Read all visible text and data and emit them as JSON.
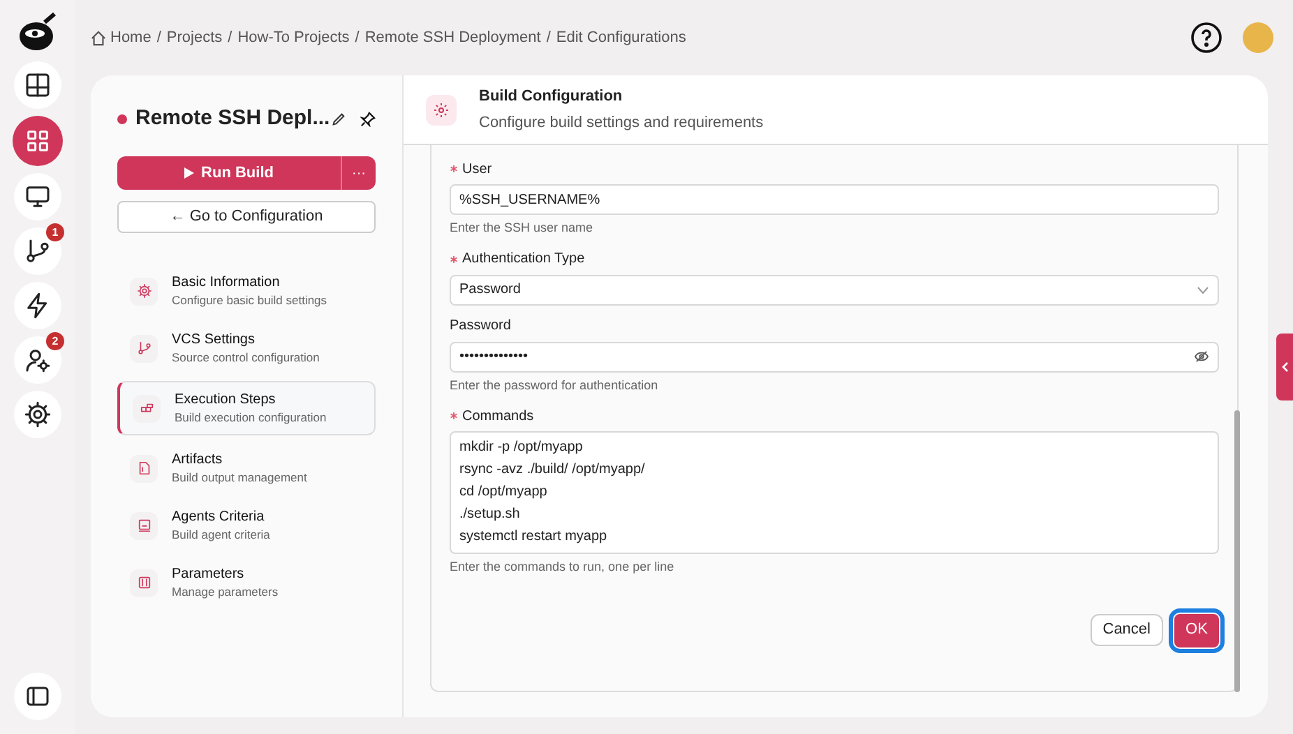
{
  "rail": {
    "items": [
      {
        "selected": false
      },
      {
        "selected": true
      },
      {
        "selected": false
      },
      {
        "selected": false,
        "badge": "1"
      },
      {
        "selected": false
      },
      {
        "selected": false,
        "badge": "2"
      },
      {
        "selected": false
      }
    ]
  },
  "breadcrumb": {
    "separator": "/",
    "items": [
      "Home",
      "Projects",
      "How-To Projects",
      "Remote SSH Deployment",
      "Edit Configurations"
    ]
  },
  "project": {
    "title": "Remote SSH Depl...",
    "run_button": "Run Build",
    "more_button": "···",
    "config_button": "← Go to Configuration"
  },
  "sections": [
    {
      "title": "Basic Information",
      "subtitle": "Configure basic build settings",
      "selected": false
    },
    {
      "title": "VCS Settings",
      "subtitle": "Source control configuration",
      "selected": false
    },
    {
      "title": "Execution Steps",
      "subtitle": "Build execution configuration",
      "selected": true
    },
    {
      "title": "Artifacts",
      "subtitle": "Build output management",
      "selected": false
    },
    {
      "title": "Agents Criteria",
      "subtitle": "Build agent criteria",
      "selected": false
    },
    {
      "title": "Parameters",
      "subtitle": "Manage parameters",
      "selected": false
    }
  ],
  "panel": {
    "title": "Build Configuration",
    "subtitle": "Configure build settings and requirements"
  },
  "fields": [
    {
      "kind": "text",
      "label": "User",
      "required": true,
      "value": "%SSH_USERNAME%",
      "help": "Enter the SSH user name"
    },
    {
      "kind": "select",
      "label": "Authentication Type",
      "required": true,
      "value": "Password"
    },
    {
      "kind": "password",
      "label": "Password",
      "required": false,
      "value": "••••••••••••••",
      "help": "Enter the password for authentication"
    },
    {
      "kind": "textarea",
      "label": "Commands",
      "required": true,
      "lines": [
        "mkdir -p /opt/myapp",
        "rsync -avz ./build/ /opt/myapp/",
        "cd /opt/myapp",
        "./setup.sh",
        "systemctl restart myapp"
      ],
      "help": "Enter the commands to run, one per line"
    }
  ],
  "buttons": {
    "cancel": "Cancel",
    "ok": "OK"
  }
}
